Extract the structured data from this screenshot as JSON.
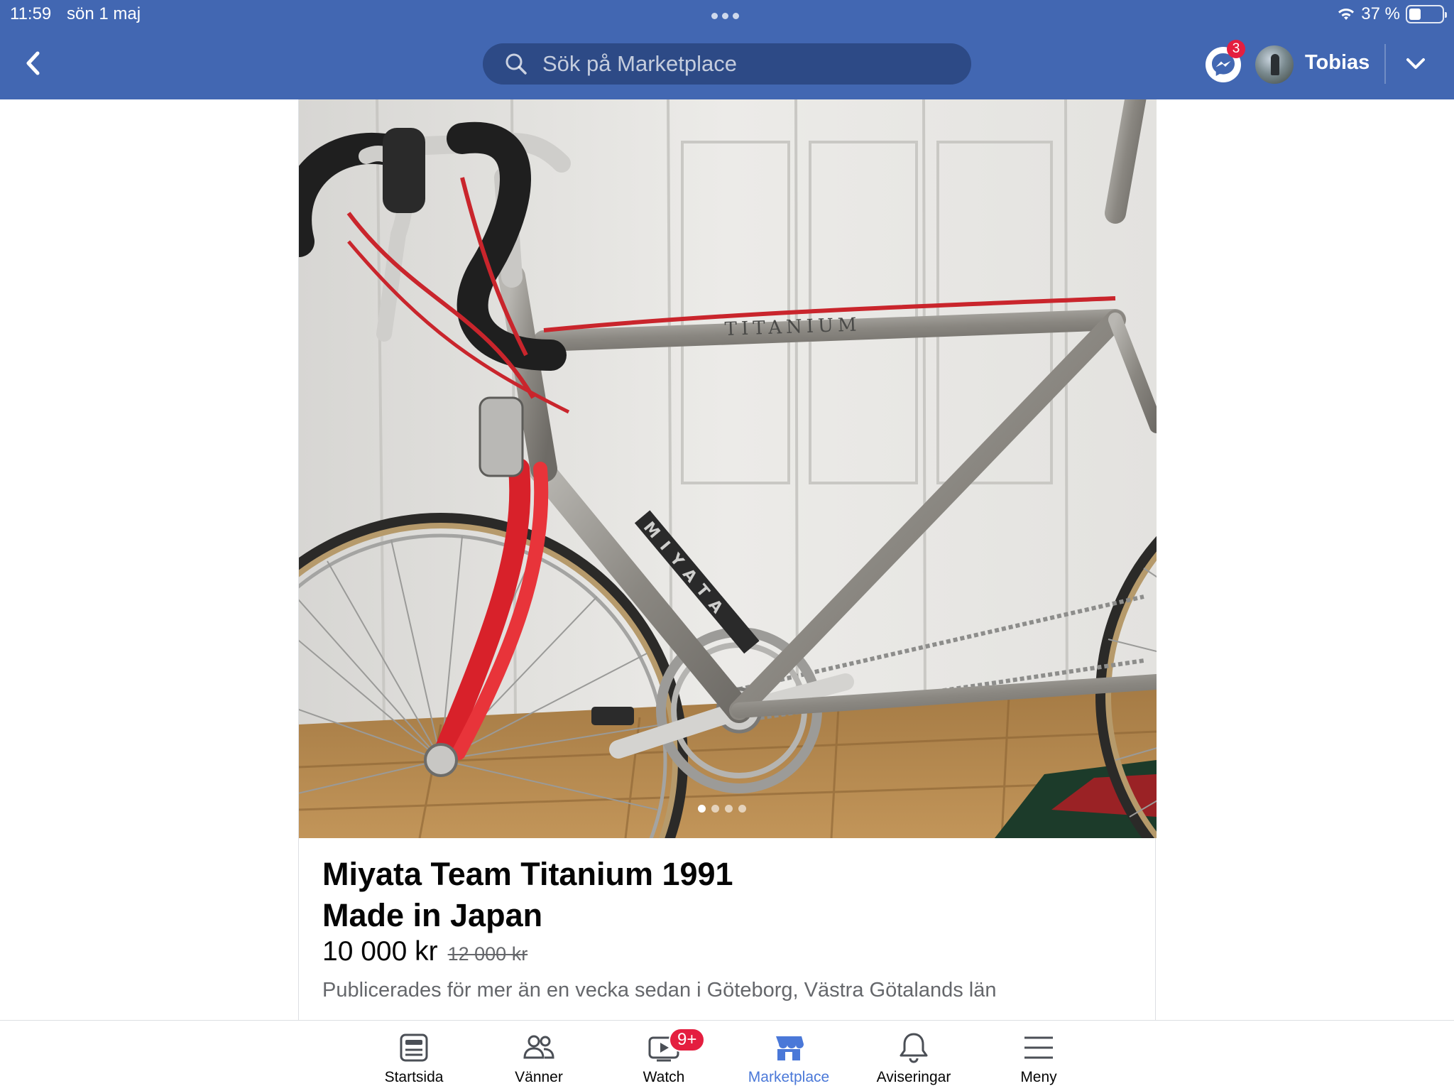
{
  "status_bar": {
    "time": "11:59",
    "date": "sön 1 maj",
    "battery_percent": "37 %",
    "battery_level": 0.37
  },
  "header": {
    "back_icon": "chevron-left-icon",
    "search_placeholder": "Sök på Marketplace",
    "messenger_badge": "3",
    "profile_name": "Tobias",
    "brand_color": "#4267b2"
  },
  "listing": {
    "title_line1": "Miyata Team Titanium 1991",
    "title_line2": "Made in Japan",
    "price": "10 000 kr",
    "old_price": "12 000 kr",
    "meta": "Publicerades för mer än en vecka sedan i Göteborg, Västra Götalands län",
    "photo_count": 4,
    "photo_active_index": 0
  },
  "tabbar": {
    "tabs": [
      {
        "label": "Startsida",
        "icon": "news-feed-icon"
      },
      {
        "label": "Vänner",
        "icon": "friends-icon"
      },
      {
        "label": "Watch",
        "icon": "watch-icon",
        "badge": "9+"
      },
      {
        "label": "Marketplace",
        "icon": "marketplace-icon",
        "active": true
      },
      {
        "label": "Aviseringar",
        "icon": "bell-icon"
      },
      {
        "label": "Meny",
        "icon": "menu-icon"
      }
    ],
    "active_color": "#4a78d8"
  }
}
